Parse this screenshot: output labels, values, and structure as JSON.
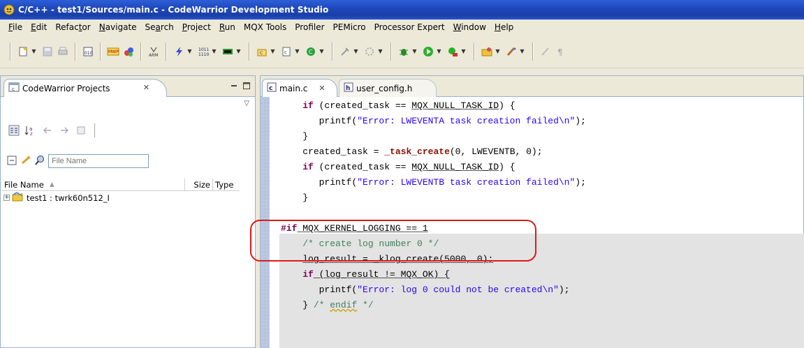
{
  "window": {
    "title": "C/C++ - test1/Sources/main.c - CodeWarrior Development Studio"
  },
  "menu": [
    {
      "label": "File",
      "mnemonic": "F"
    },
    {
      "label": "Edit",
      "mnemonic": "E"
    },
    {
      "label": "Refactor",
      "mnemonic": "t"
    },
    {
      "label": "Navigate",
      "mnemonic": "N"
    },
    {
      "label": "Search",
      "mnemonic": "a"
    },
    {
      "label": "Project",
      "mnemonic": "P"
    },
    {
      "label": "Run",
      "mnemonic": "R"
    },
    {
      "label": "MQX Tools",
      "mnemonic": ""
    },
    {
      "label": "Profiler",
      "mnemonic": ""
    },
    {
      "label": "PEMicro",
      "mnemonic": ""
    },
    {
      "label": "Processor Expert",
      "mnemonic": ""
    },
    {
      "label": "Window",
      "mnemonic": "W"
    },
    {
      "label": "Help",
      "mnemonic": "H"
    }
  ],
  "toolbar_icons": [
    "new-icon",
    "save-icon",
    "print-icon",
    "binary-icon",
    "mwp-icon",
    "wizard-icon",
    "arm-icon",
    "build-icon",
    "memory-icon",
    "register-icon",
    "new-project-icon",
    "new-source-icon",
    "new-class-icon",
    "build-all-icon",
    "clean-icon",
    "debug-icon",
    "run-icon",
    "external-tools-icon",
    "open-type-icon",
    "search-icon",
    "toggle-icon",
    "paragraph-icon"
  ],
  "left_panel": {
    "tab_title": "CodeWarrior Projects",
    "filter_placeholder": "File Name",
    "columns": {
      "name": "File Name",
      "size": "Size",
      "type": "Type"
    },
    "tree": [
      {
        "label": "test1 : twrk60n512_I",
        "expanded": false
      }
    ]
  },
  "editor": {
    "tabs": [
      {
        "label": "main.c",
        "active": true,
        "badge": "c"
      },
      {
        "label": "user_config.h",
        "active": false,
        "badge": "h"
      }
    ],
    "code": {
      "l1_kw": "if",
      "l1_a": " (created_task == ",
      "l1_macro": "MQX_NULL_TASK_ID",
      "l1_b": ") {",
      "l2_a": "printf(",
      "l2_str": "\"Error: LWEVENTA task creation failed\\n\"",
      "l2_b": ");",
      "l3": "}",
      "l4_a": "created_task = ",
      "l4_fn": "_task_create",
      "l4_b": "(0, LWEVENTB, 0);",
      "l5_kw": "if",
      "l5_a": " (created_task == ",
      "l5_macro": "MQX_NULL_TASK_ID",
      "l5_b": ") {",
      "l6_a": "printf(",
      "l6_str": "\"Error: LWEVENTB task creation failed\\n\"",
      "l6_b": ");",
      "l7": "}",
      "l9_pp": "#if",
      "l9_a": " MQX_KERNEL_LOGGING == 1",
      "l10_cmt": "/* create log number 0 */",
      "l11": "log_result = _klog_create(5000, 0);",
      "l12_kw": "if",
      "l12_a": " (log_result != MQX_OK) {",
      "l13_a": "printf(",
      "l13_str": "\"Error: log 0 could not be created\\n\"",
      "l13_b": ");",
      "l14_a": "} ",
      "l14_cmt1": "/* ",
      "l14_sq": "endif",
      "l14_cmt2": " */"
    }
  }
}
